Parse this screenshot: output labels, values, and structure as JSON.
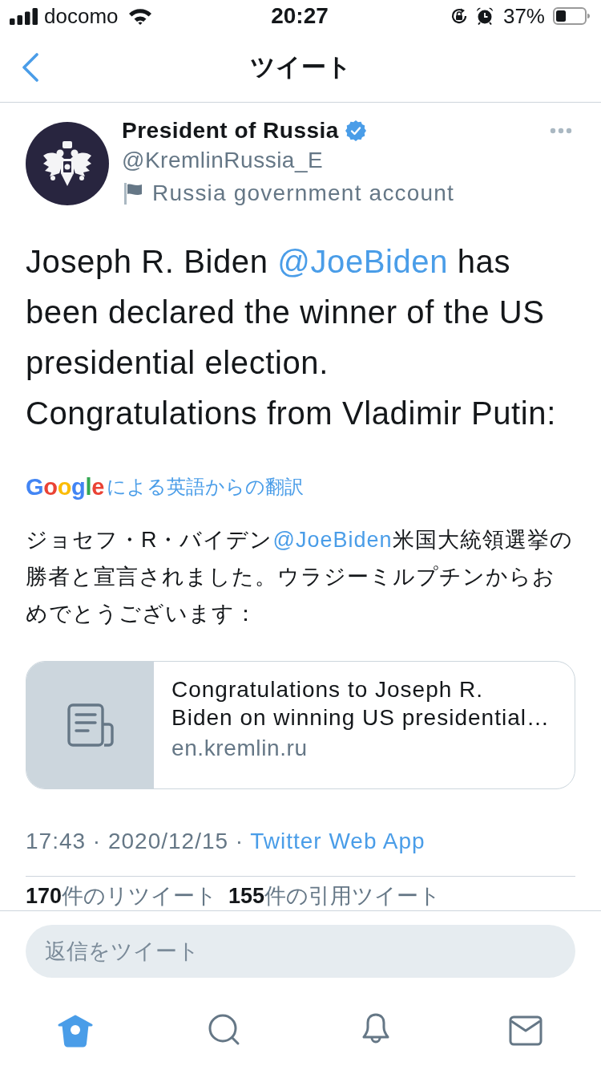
{
  "status_bar": {
    "carrier": "docomo",
    "time": "20:27",
    "battery": "37%"
  },
  "nav": {
    "title": "ツイート"
  },
  "tweet": {
    "author": {
      "name": "President of Russia",
      "verified": true,
      "handle": "@KremlinRussia_E",
      "label": "Russia government account"
    },
    "text": [
      {
        "kind": "text",
        "text": "Joseph R. Biden "
      },
      {
        "kind": "mention",
        "text": "@JoeBiden"
      },
      {
        "kind": "text",
        "text": " has been declared the winner of the US presidential election.\nCongratulations from Vladimir Putin:"
      }
    ],
    "translation": {
      "provider": "Google",
      "label": "による英語からの翻訳",
      "text": [
        {
          "kind": "text",
          "text": "ジョセフ・R・バイデン"
        },
        {
          "kind": "mention",
          "text": "@JoeBiden"
        },
        {
          "kind": "text",
          "text": "米国大統領選挙の勝者と宣言されました。ウラジーミルプチンからおめでとうございます："
        }
      ]
    },
    "card": {
      "title": "Congratulations to Joseph R. Biden on winning US presidential…",
      "domain": "en.kremlin.ru"
    },
    "timestamp": "17:43 · 2020/12/15 ·",
    "source": "Twitter Web App",
    "stats": [
      {
        "count": "170",
        "label": "件のリツイート"
      },
      {
        "count": "155",
        "label": "件の引用ツイート"
      }
    ]
  },
  "reply": {
    "placeholder": "返信をツイート"
  },
  "tabs": [
    {
      "kind": "home",
      "selected": true
    },
    {
      "kind": "search",
      "selected": false
    },
    {
      "kind": "notifications",
      "selected": false
    },
    {
      "kind": "messages",
      "selected": false
    }
  ]
}
